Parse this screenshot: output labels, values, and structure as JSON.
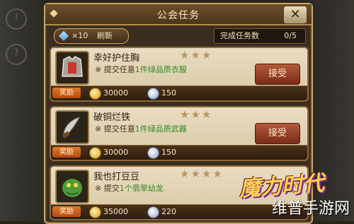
{
  "panel": {
    "title": "公会任务",
    "refresh": {
      "multiplier": "×10",
      "label": "刷新"
    },
    "progress": {
      "label": "完成任务数",
      "value": "0/5"
    }
  },
  "reward_label": "奖励",
  "accept_label": "接受",
  "tasks": [
    {
      "name": "幸好护住胸",
      "stars": "★★★",
      "desc_prefix": "※ 提交任意",
      "desc_qty": "1件",
      "desc_item": "绿品质衣服",
      "coins": "30000",
      "orbs": "150"
    },
    {
      "name": "破铜烂铁",
      "stars": "★★★",
      "desc_prefix": "※ 提交任意",
      "desc_qty": "1件",
      "desc_item": "绿品质武器",
      "coins": "30000",
      "orbs": "150"
    },
    {
      "name": "我也打豆豆",
      "stars": "★★★★",
      "desc_prefix": "※ 提交",
      "desc_qty": "1个",
      "desc_item": "翡翠幼龙",
      "coins": "35000",
      "orbs": "220"
    }
  ],
  "watermarks": {
    "game_logo": "魔力时代",
    "site": "维普手游网"
  },
  "icons": {
    "gem": "diamond-icon",
    "coin": "gold-coin-icon",
    "orb": "silver-orb-icon",
    "task1": "armor-icon",
    "task2": "dagger-icon",
    "task3": "dragon-icon"
  }
}
